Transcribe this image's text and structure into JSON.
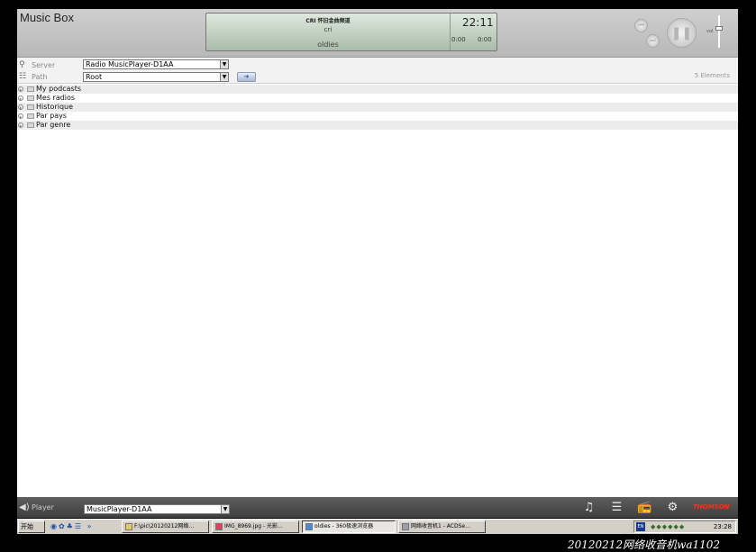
{
  "app": {
    "title": "Music Box"
  },
  "now_playing": {
    "station": "CRI 怀旧金曲频道",
    "subtitle": "cri",
    "genre": "oldies",
    "clock": "22:11",
    "elapsed": "0:00",
    "remaining": "0:00"
  },
  "controls": {
    "prev_glyph": "⏮",
    "next_glyph": "⏭",
    "pause_glyph": "❚❚",
    "volume_label": "vol",
    "volume_level": 0.6
  },
  "selector": {
    "server_label": "Server",
    "server_value": "Radio MusicPlayer-D1AA",
    "path_label": "Path",
    "path_value": "Root",
    "go_glyph": "➔",
    "element_count": "5 Elements"
  },
  "tree": {
    "items": [
      {
        "label": "My podcasts"
      },
      {
        "label": "Mes radios"
      },
      {
        "label": "Historique"
      },
      {
        "label": "Par pays"
      },
      {
        "label": "Par genre"
      }
    ]
  },
  "player_bar": {
    "label": "Player",
    "player_value": "MusicPlayer-D1AA",
    "music_icon": "♫",
    "rss_icon": "☰",
    "radio_icon": "📻",
    "settings_icon": "⚙",
    "brand": "THOMSON"
  },
  "taskbar": {
    "start_label": "开始",
    "quicklaunch": "◉✿♣☰  »",
    "tasks": [
      {
        "label": "F:\\pic\\20120212网络…"
      },
      {
        "label": "IMG_8969.jpg - 光影…"
      },
      {
        "label": "oldies - 360极速浏览器"
      },
      {
        "label": "网络收音机1 - ACDSe…"
      }
    ],
    "tray_lang": "EN",
    "tray_icons": "◆◆◆◆◆◆",
    "time": "23:28"
  },
  "caption": "20120212网络收音机wa1102"
}
